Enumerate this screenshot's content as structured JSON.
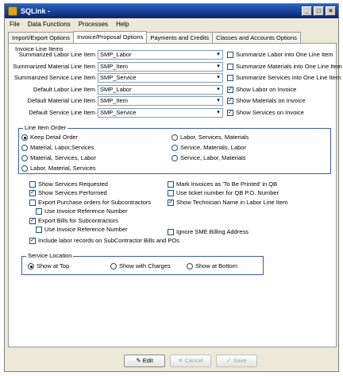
{
  "window": {
    "title": "SQLink - "
  },
  "menu": [
    "File",
    "Data Functions",
    "Processes",
    "Help"
  ],
  "tabs": [
    "Import/Export Options",
    "Invoice/Proposal Options",
    "Payments and Credits",
    "Classes and Accounts Options"
  ],
  "invoice_line_items": {
    "title": "Invoice Line Items",
    "rows": [
      {
        "label": "Summarized Labor Line Item",
        "value": "SMP_Labor",
        "check": "Summarize Labor into One Line Item",
        "checked": false
      },
      {
        "label": "Summarized Material Line Item",
        "value": "SMP_Item",
        "check": "Summarize Materials into One Line Item",
        "checked": false
      },
      {
        "label": "Summarized Service Line Item",
        "value": "SMP_Service",
        "check": "Summarize Services into One Line Item",
        "checked": false
      },
      {
        "label": "Default Labor Line Item",
        "value": "SMP_Labor",
        "check": "Show Labor on Invoice",
        "checked": true
      },
      {
        "label": "Default Material Line Item",
        "value": "SMP_Item",
        "check": "Show Materials on Invoice",
        "checked": true
      },
      {
        "label": "Default Service Line Item",
        "value": "SMP_Service",
        "check": "Show Services on Invoice",
        "checked": true
      }
    ]
  },
  "line_item_order": {
    "title": "Line Item Order",
    "left": [
      "Keep Detail Order",
      "Material, Labor,Services",
      "Material, Services, Labor",
      "Labor, Material, Services"
    ],
    "right": [
      "Labor, Services, Materials",
      "Service, Materials, Labor",
      "Service, Labor, Materials"
    ]
  },
  "options_left": [
    {
      "label": "Show Services Requested",
      "checked": false
    },
    {
      "label": "Show Services Performed",
      "checked": true
    },
    {
      "label": "Export Purchase orders for Subcontractors",
      "checked": false
    },
    {
      "label": "Use Invoice Reference Number",
      "checked": false
    },
    {
      "label": "Export Bills for Subcontractors",
      "checked": true
    },
    {
      "label": "Use Invoice Reference Number",
      "checked": false
    },
    {
      "label": "Include labor records on SubContractor Bills and POs",
      "checked": true
    }
  ],
  "options_right": [
    {
      "label": "Mark Invoices as 'To Be Printed' in QB",
      "checked": false
    },
    {
      "label": "Use ticket number for QB P.O. Number",
      "checked": false
    },
    {
      "label": "Show Technician Name in Labor Line Item",
      "checked": true
    },
    {
      "label": "Ignore SME Billing Address",
      "checked": false
    }
  ],
  "service_location": {
    "title": "Service Location",
    "options": [
      "Show at Top",
      "Show with Charges",
      "Show at Bottom"
    ]
  },
  "buttons": {
    "edit": "Edit",
    "cancel": "Cancel",
    "save": "Save"
  }
}
